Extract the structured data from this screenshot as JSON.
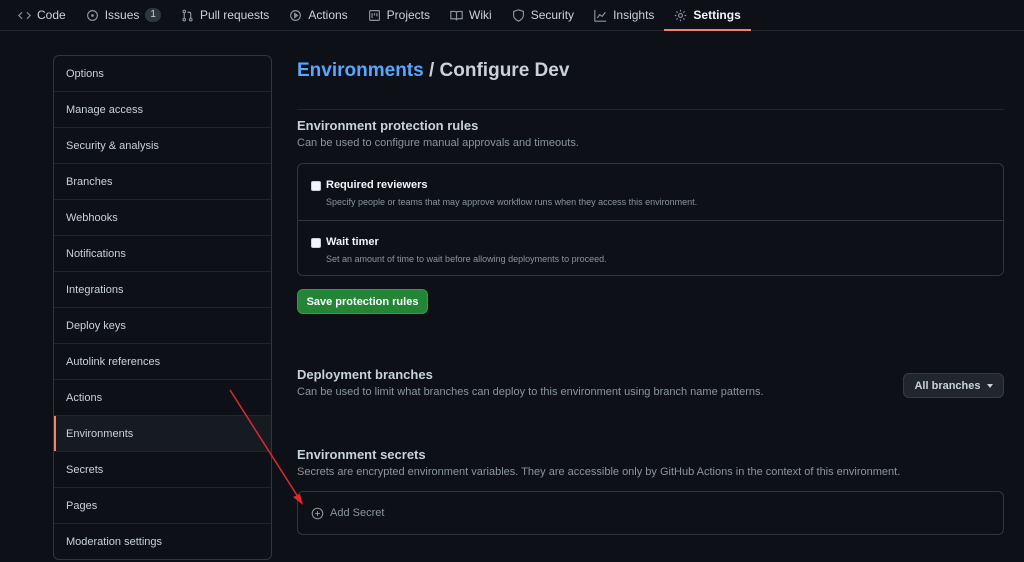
{
  "nav": {
    "tabs": [
      {
        "label": "Code"
      },
      {
        "label": "Issues",
        "count": "1"
      },
      {
        "label": "Pull requests"
      },
      {
        "label": "Actions"
      },
      {
        "label": "Projects"
      },
      {
        "label": "Wiki"
      },
      {
        "label": "Security"
      },
      {
        "label": "Insights"
      },
      {
        "label": "Settings",
        "active": true
      }
    ]
  },
  "sidebar": {
    "items": [
      {
        "label": "Options"
      },
      {
        "label": "Manage access"
      },
      {
        "label": "Security & analysis"
      },
      {
        "label": "Branches"
      },
      {
        "label": "Webhooks"
      },
      {
        "label": "Notifications"
      },
      {
        "label": "Integrations"
      },
      {
        "label": "Deploy keys"
      },
      {
        "label": "Autolink references"
      },
      {
        "label": "Actions"
      },
      {
        "label": "Environments",
        "active": true
      },
      {
        "label": "Secrets"
      },
      {
        "label": "Pages"
      },
      {
        "label": "Moderation settings"
      }
    ]
  },
  "main": {
    "breadcrumb_link": "Environments",
    "breadcrumb_sep": " / ",
    "breadcrumb_current": "Configure Dev",
    "protection": {
      "heading": "Environment protection rules",
      "desc": "Can be used to configure manual approvals and timeouts.",
      "rules": [
        {
          "title": "Required reviewers",
          "desc": "Specify people or teams that may approve workflow runs when they access this environment."
        },
        {
          "title": "Wait timer",
          "desc": "Set an amount of time to wait before allowing deployments to proceed."
        }
      ],
      "save_label": "Save protection rules"
    },
    "deployment": {
      "heading": "Deployment branches",
      "desc": "Can be used to limit what branches can deploy to this environment using branch name patterns.",
      "select_label": "All branches"
    },
    "secrets": {
      "heading": "Environment secrets",
      "desc": "Secrets are encrypted environment variables. They are accessible only by GitHub Actions in the context of this environment.",
      "add_label": "Add Secret"
    }
  },
  "colors": {
    "accent": "#f78166",
    "link": "#58a6ff",
    "primary_button": "#238636",
    "annotation_arrow": "#e0282e"
  }
}
